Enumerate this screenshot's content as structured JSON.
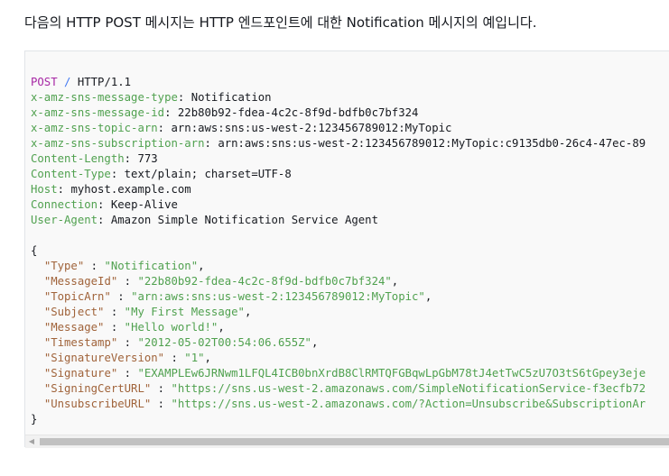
{
  "intro": "다음의 HTTP POST 메시지는 HTTP 엔드포인트에 대한 Notification 메시지의 예입니다.",
  "request": {
    "method": "POST",
    "slash": "/",
    "version": "HTTP/1.1",
    "headers": [
      {
        "name": "x-amz-sns-message-type",
        "value": "Notification"
      },
      {
        "name": "x-amz-sns-message-id",
        "value": "22b80b92-fdea-4c2c-8f9d-bdfb0c7bf324"
      },
      {
        "name": "x-amz-sns-topic-arn",
        "value": "arn:aws:sns:us-west-2:123456789012:MyTopic"
      },
      {
        "name": "x-amz-sns-subscription-arn",
        "value": "arn:aws:sns:us-west-2:123456789012:MyTopic:c9135db0-26c4-47ec-89"
      },
      {
        "name": "Content-Length",
        "value": "773"
      },
      {
        "name": "Content-Type",
        "value": "text/plain; charset=UTF-8"
      },
      {
        "name": "Host",
        "value": "myhost.example.com"
      },
      {
        "name": "Connection",
        "value": "Keep-Alive"
      },
      {
        "name": "User-Agent",
        "value": "Amazon Simple Notification Service Agent"
      }
    ],
    "body_open": "{",
    "body_close": "}",
    "body": [
      {
        "key": "\"Type\"",
        "value": "\"Notification\"",
        "comma": true
      },
      {
        "key": "\"MessageId\"",
        "value": "\"22b80b92-fdea-4c2c-8f9d-bdfb0c7bf324\"",
        "comma": true
      },
      {
        "key": "\"TopicArn\"",
        "value": "\"arn:aws:sns:us-west-2:123456789012:MyTopic\"",
        "comma": true
      },
      {
        "key": "\"Subject\"",
        "value": "\"My First Message\"",
        "comma": true
      },
      {
        "key": "\"Message\"",
        "value": "\"Hello world!\"",
        "comma": true
      },
      {
        "key": "\"Timestamp\"",
        "value": "\"2012-05-02T00:54:06.655Z\"",
        "comma": true
      },
      {
        "key": "\"SignatureVersion\"",
        "value": "\"1\"",
        "comma": true
      },
      {
        "key": "\"Signature\"",
        "value": "\"EXAMPLEw6JRNwm1LFQL4ICB0bnXrdB8ClRMTQFGBqwLpGbM78tJ4etTwC5zU7O3tS6tGpey3eje",
        "comma": false
      },
      {
        "key": "\"SigningCertURL\"",
        "value": "\"https://sns.us-west-2.amazonaws.com/SimpleNotificationService-f3ecfb72",
        "comma": false
      },
      {
        "key": "\"UnsubscribeURL\"",
        "value": "\"https://sns.us-west-2.amazonaws.com/?Action=Unsubscribe&SubscriptionAr",
        "comma": false
      }
    ]
  },
  "scrollbar": {
    "left_arrow": "◀"
  }
}
